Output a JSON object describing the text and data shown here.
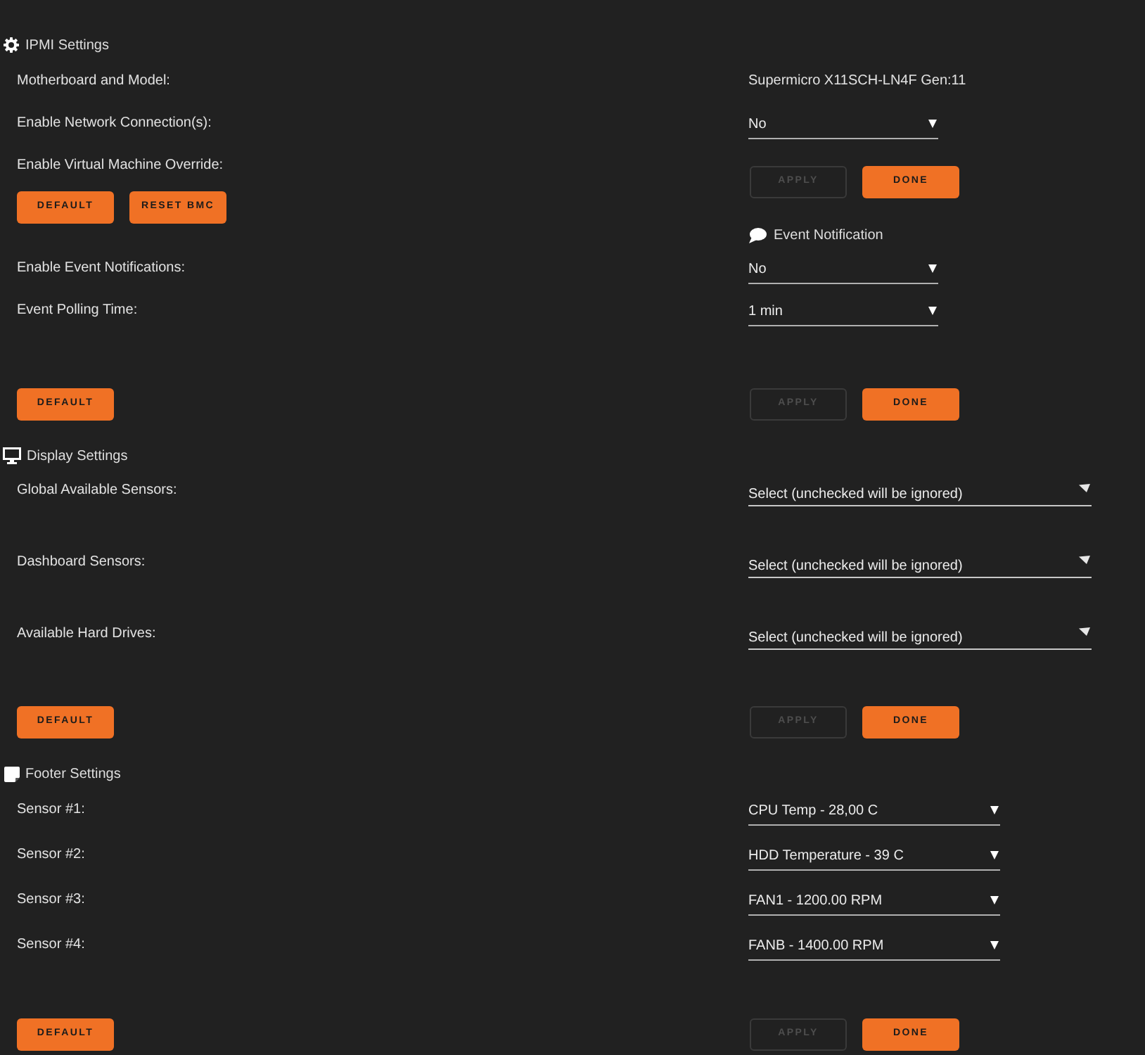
{
  "sections": [
    {
      "title": "IPMI Settings",
      "groups": [
        {
          "rows": [
            {
              "kind": "text",
              "label": "Motherboard and Model:",
              "value": "Supermicro X11SCH-LN4F Gen:11"
            },
            {
              "kind": "select",
              "label": "Enable Network Connection(s):",
              "value": "No"
            },
            {
              "kind": "label",
              "label": "Enable Virtual Machine Override:"
            }
          ],
          "left_buttons": [
            {
              "label": "DEFAULT",
              "disabled": false
            },
            {
              "label": "RESET BMC",
              "disabled": false
            }
          ],
          "right_buttons": [
            {
              "label": "APPLY",
              "disabled": true
            },
            {
              "label": "DONE",
              "disabled": false
            }
          ]
        },
        {
          "subtitle": "Event Notification",
          "rows": [
            {
              "kind": "select",
              "label": "Enable Event Notifications:",
              "value": "No"
            },
            {
              "kind": "select",
              "label": "Event Polling Time:",
              "value": "1 min"
            }
          ],
          "left_buttons": [
            {
              "label": "DEFAULT",
              "disabled": false
            }
          ],
          "right_buttons": [
            {
              "label": "APPLY",
              "disabled": true
            },
            {
              "label": "DONE",
              "disabled": false
            }
          ]
        }
      ]
    },
    {
      "title": "Display Settings",
      "groups": [
        {
          "rows": [
            {
              "kind": "multiselect",
              "label": "Global Available Sensors:",
              "value": "Select (unchecked will be ignored)"
            },
            {
              "kind": "multiselect",
              "label": "Dashboard Sensors:",
              "value": "Select (unchecked will be ignored)"
            },
            {
              "kind": "multiselect",
              "label": "Available Hard Drives:",
              "value": "Select (unchecked will be ignored)"
            }
          ],
          "left_buttons": [
            {
              "label": "DEFAULT",
              "disabled": false
            }
          ],
          "right_buttons": [
            {
              "label": "APPLY",
              "disabled": true
            },
            {
              "label": "DONE",
              "disabled": false
            }
          ]
        }
      ]
    },
    {
      "title": "Footer Settings",
      "groups": [
        {
          "rows": [
            {
              "kind": "select",
              "label": "Sensor #1:",
              "value": "CPU Temp - 28,00 C"
            },
            {
              "kind": "select",
              "label": "Sensor #2:",
              "value": "HDD Temperature - 39 C"
            },
            {
              "kind": "select",
              "label": "Sensor #3:",
              "value": "FAN1 - 1200.00 RPM"
            },
            {
              "kind": "select",
              "label": "Sensor #4:",
              "value": "FANB - 1400.00 RPM"
            }
          ],
          "left_buttons": [
            {
              "label": "DEFAULT",
              "disabled": false
            }
          ],
          "right_buttons": [
            {
              "label": "APPLY",
              "disabled": true
            },
            {
              "label": "DONE",
              "disabled": false
            }
          ]
        }
      ]
    }
  ]
}
